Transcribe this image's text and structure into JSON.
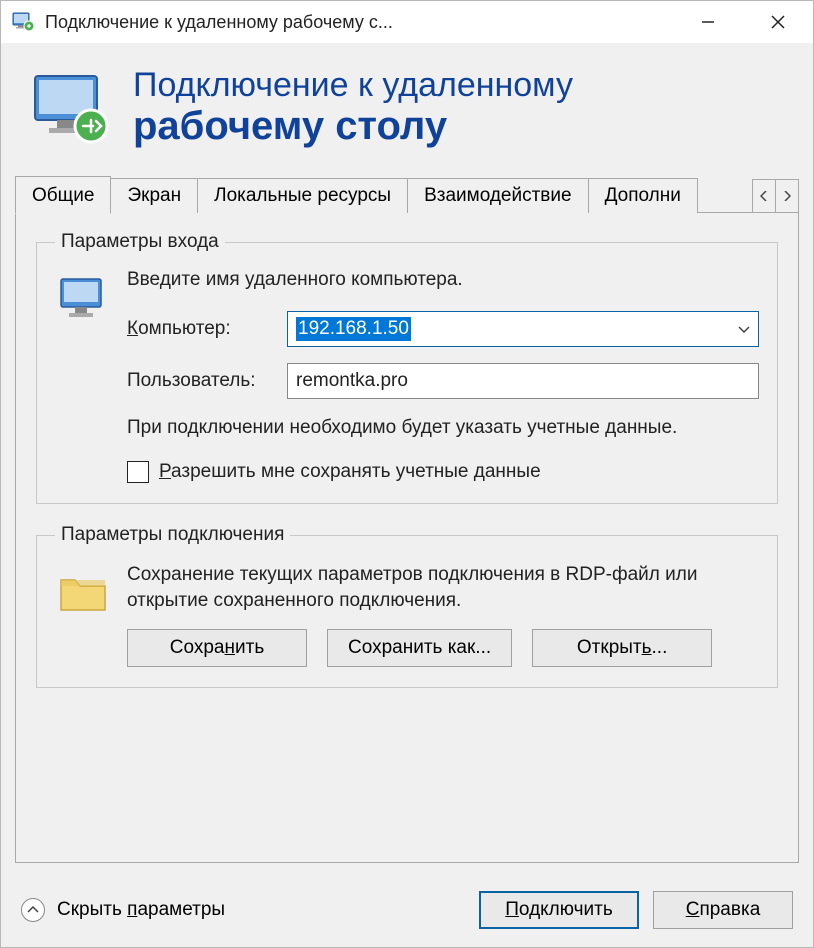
{
  "window": {
    "title": "Подключение к удаленному рабочему с..."
  },
  "header": {
    "line1": "Подключение к удаленному",
    "line2": "рабочему столу"
  },
  "tabs": [
    "Общие",
    "Экран",
    "Локальные ресурсы",
    "Взаимодействие",
    "Дополни"
  ],
  "login_group": {
    "legend": "Параметры входа",
    "instruction": "Введите имя удаленного компьютера.",
    "computer_label": "Компьютер:",
    "computer_value": "192.168.1.50",
    "user_label": "Пользователь:",
    "user_value": "remontka.pro",
    "cred_note": "При подключении необходимо будет указать учетные данные.",
    "allow_save_label": "Разрешить мне сохранять учетные данные"
  },
  "conn_group": {
    "legend": "Параметры подключения",
    "description": "Сохранение текущих параметров подключения в RDP-файл или открытие сохраненного подключения.",
    "save": "Сохранить",
    "save_as": "Сохранить как...",
    "open": "Открыть..."
  },
  "footer": {
    "hide": "Скрыть параметры",
    "connect": "Подключить",
    "help": "Справка"
  }
}
